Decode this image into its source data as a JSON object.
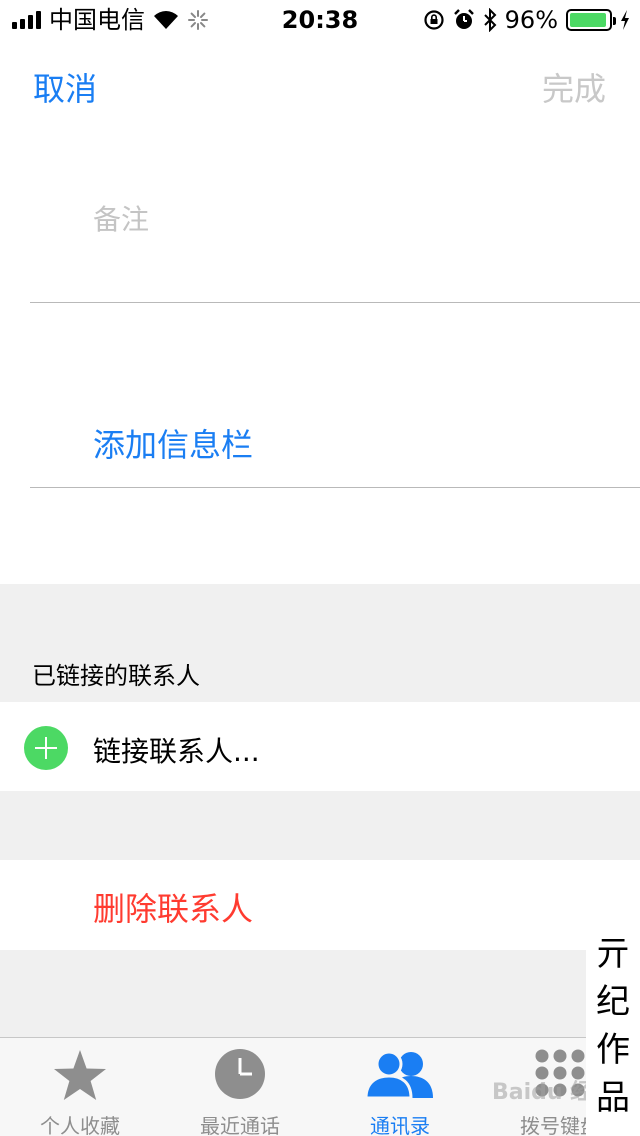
{
  "status_bar": {
    "carrier": "中国电信",
    "time": "20:38",
    "battery_percent": "96%",
    "battery_level": 0.96,
    "icons": [
      "signal-icon",
      "wifi-icon",
      "activity-spinner-icon",
      "orientation-lock-icon",
      "alarm-icon",
      "bluetooth-icon",
      "battery-icon",
      "charging-icon"
    ]
  },
  "nav": {
    "cancel": "取消",
    "done": "完成"
  },
  "note": {
    "placeholder": "备注"
  },
  "add_field": "添加信息栏",
  "linked": {
    "header": "已链接的联系人",
    "link_label": "链接联系人..."
  },
  "delete_label": "删除联系人",
  "tabs": [
    {
      "label": "个人收藏",
      "icon": "star-icon"
    },
    {
      "label": "最近通话",
      "icon": "clock-icon"
    },
    {
      "label": "通讯录",
      "icon": "contacts-icon",
      "active": true
    },
    {
      "label": "拨号键盘",
      "icon": "keypad-icon"
    }
  ],
  "watermark": {
    "stamp": "亓纪作品",
    "brand": "Baidu 经验"
  },
  "colors": {
    "accent": "#1a7ef3",
    "destructive": "#ff3b30",
    "add_green": "#4cd964",
    "section_grey": "#f0f0f0"
  }
}
